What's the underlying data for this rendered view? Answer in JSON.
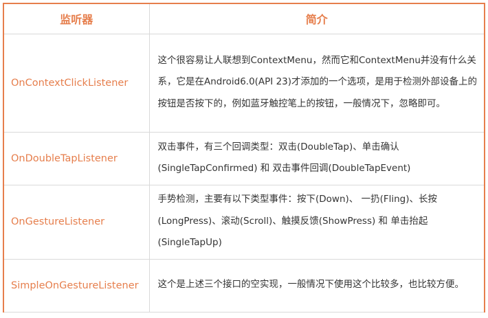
{
  "table": {
    "headers": [
      "监听器",
      "简介"
    ],
    "rows": [
      {
        "name": "OnContextClickListener",
        "description": "这个很容易让人联想到ContextMenu，然而它和ContextMenu并没有什么关系，它是在Android6.0(API 23)才添加的一个选项，是用于检测外部设备上的按钮是否按下的，例如蓝牙触控笔上的按钮，一般情况下，忽略即可。"
      },
      {
        "name": "OnDoubleTapListener",
        "description": "双击事件，有三个回调类型：双击(DoubleTap)、单击确认(SingleTapConfirmed) 和 双击事件回调(DoubleTapEvent)"
      },
      {
        "name": "OnGestureListener",
        "description": "手势检测，主要有以下类型事件：按下(Down)、 一扔(Fling)、长按(LongPress)、滚动(Scroll)、触摸反馈(ShowPress) 和 单击抬起(SingleTapUp)"
      },
      {
        "name": "SimpleOnGestureListener",
        "description": "这个是上述三个接口的空实现，一般情况下使用这个比较多，也比较方便。"
      }
    ]
  },
  "colors": {
    "accent": "#e67e4c",
    "text": "#333333",
    "grid": "#d9d9d9"
  }
}
